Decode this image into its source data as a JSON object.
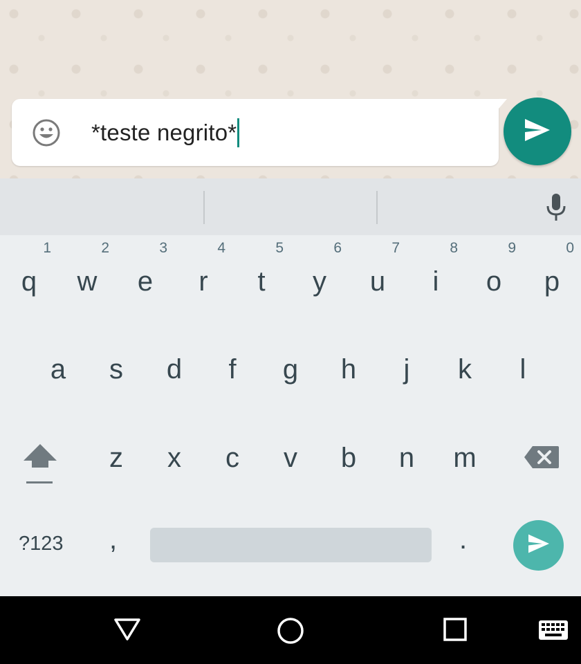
{
  "compose": {
    "text": "*teste negrito*",
    "emoji_icon": "smiley-face-icon",
    "send_icon": "send-arrow-icon"
  },
  "keyboard": {
    "suggestion_bar": {
      "mic_icon": "microphone-icon"
    },
    "row1": [
      {
        "letter": "q",
        "num": "1"
      },
      {
        "letter": "w",
        "num": "2"
      },
      {
        "letter": "e",
        "num": "3"
      },
      {
        "letter": "r",
        "num": "4"
      },
      {
        "letter": "t",
        "num": "5"
      },
      {
        "letter": "y",
        "num": "6"
      },
      {
        "letter": "u",
        "num": "7"
      },
      {
        "letter": "i",
        "num": "8"
      },
      {
        "letter": "o",
        "num": "9"
      },
      {
        "letter": "p",
        "num": "0"
      }
    ],
    "row2": [
      "a",
      "s",
      "d",
      "f",
      "g",
      "h",
      "j",
      "k",
      "l"
    ],
    "row3": [
      "z",
      "x",
      "c",
      "v",
      "b",
      "n",
      "m"
    ],
    "shift_icon": "shift-arrow-icon",
    "backspace_icon": "backspace-icon",
    "symbols_label": "?123",
    "comma_label": ",",
    "period_label": ".",
    "enter_icon": "send-arrow-icon"
  },
  "navbar": {
    "back_icon": "back-triangle-icon",
    "home_icon": "home-circle-icon",
    "recents_icon": "recents-square-icon",
    "keyboard_icon": "keyboard-switch-icon"
  },
  "colors": {
    "accent": "#128c7e",
    "enter_key": "#4db6ac",
    "key_text": "#37474f",
    "keyboard_bg": "#eceff1"
  }
}
